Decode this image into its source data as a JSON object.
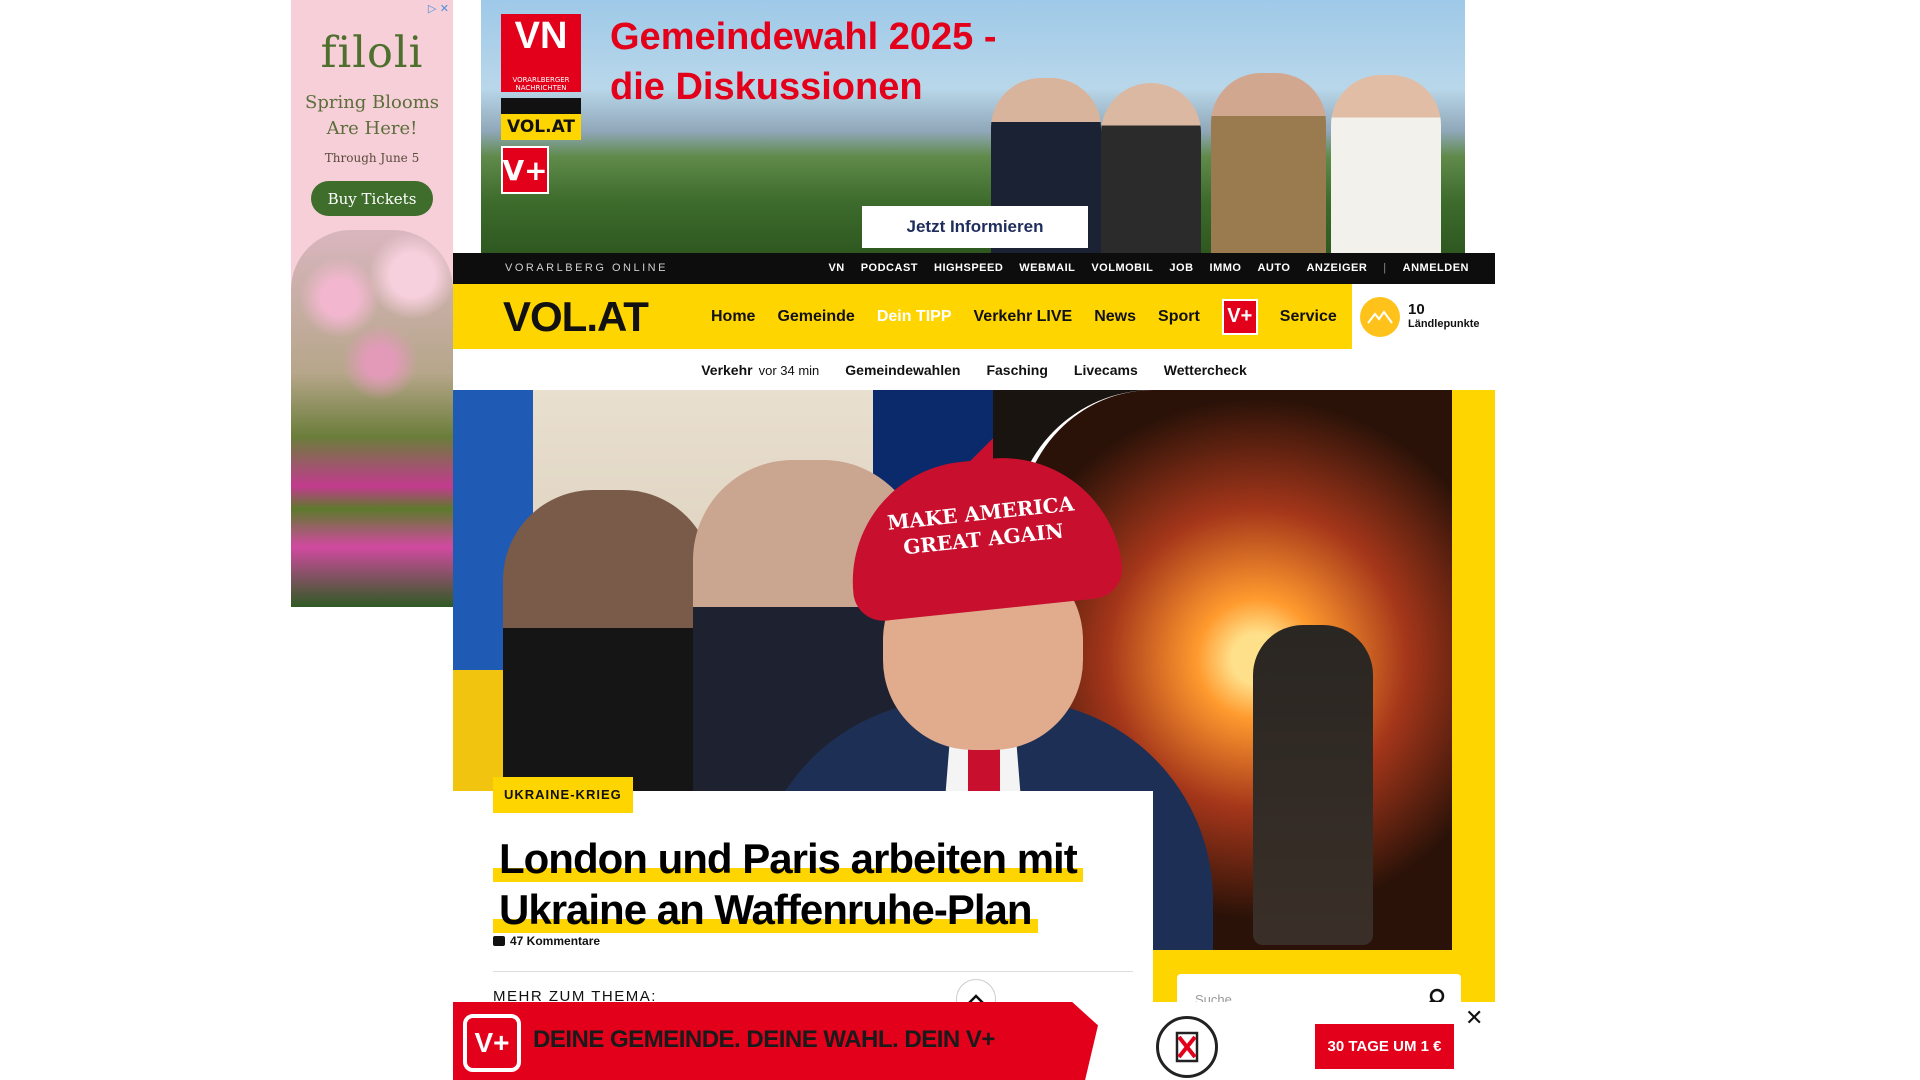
{
  "side_ad": {
    "adchoices": "▷ ✕",
    "brand": "filoli",
    "headline_line1": "Spring Blooms",
    "headline_line2": "Are Here!",
    "sub": "Through June 5",
    "cta": "Buy Tickets"
  },
  "top_banner": {
    "vn_logo": "VN",
    "vn_sub": "VORARLBERGER NACHRICHTEN",
    "vol_logo": "VOL.AT",
    "vplus": "V+",
    "title_line1": "Gemeindewahl 2025 -",
    "title_line2": "die Diskussionen",
    "cta": "Jetzt Informieren"
  },
  "topnav": {
    "brand": "VORARLBERG ONLINE",
    "links": [
      "VN",
      "PODCAST",
      "HIGHSPEED",
      "WEBMAIL",
      "VOLMOBIL",
      "JOB",
      "IMMO",
      "AUTO",
      "ANZEIGER"
    ],
    "separator": "|",
    "login": "ANMELDEN"
  },
  "mainnav": {
    "logo": "VOL.AT",
    "items": [
      "Home",
      "Gemeinde",
      "Dein TIPP",
      "Verkehr LIVE",
      "News",
      "Sport"
    ],
    "vplus": "V+",
    "service": "Service",
    "points_value": "10",
    "points_label": "Ländlepunkte"
  },
  "subnav": {
    "verkehr": "Verkehr",
    "verkehr_time": "vor 34 min",
    "links": [
      "Gemeindewahlen",
      "Fasching",
      "Livecams",
      "Wettercheck"
    ]
  },
  "hero": {
    "cap_text_line1": "MAKE AMERICA",
    "cap_text_line2": "GREAT AGAIN",
    "tag": "UKRAINE-KRIEG",
    "headline_line1": "London und Paris arbeiten mit",
    "headline_line2": "Ukraine an Waffenruhe-Plan",
    "comments": "47 Kommentare",
    "more": "MEHR ZUM THEMA:"
  },
  "search": {
    "placeholder": "Suche"
  },
  "bottom_ad": {
    "vplus": "V+",
    "slogan": "DEINE GEMEINDE. DEINE WAHL. DEIN V+",
    "cta": "30 TAGE UM 1 €",
    "close": "✕"
  },
  "colors": {
    "brand_yellow": "#ffd500",
    "brand_red": "#e3001b",
    "nav_black": "#0d0d0d"
  }
}
